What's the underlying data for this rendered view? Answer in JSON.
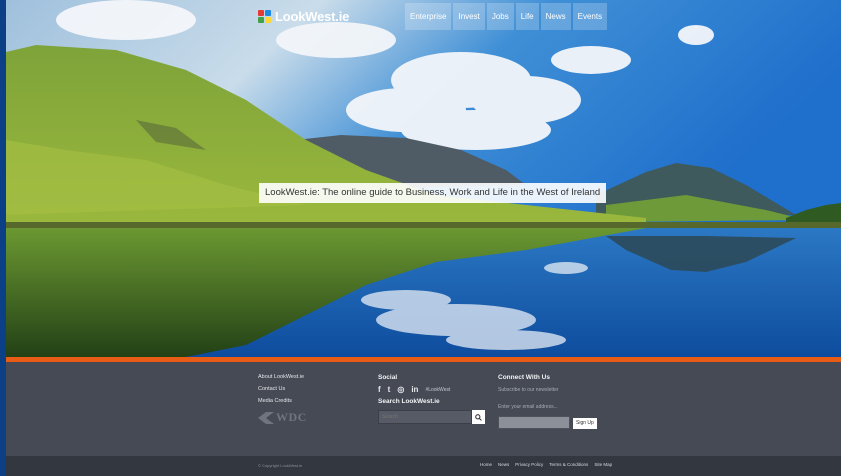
{
  "site": {
    "logo_text": "LookWest.ie",
    "tagline": "LookWest.ie: The online guide to Business, Work and Life in the West of Ireland"
  },
  "nav": {
    "items": [
      {
        "label": "Enterprise"
      },
      {
        "label": "Invest"
      },
      {
        "label": "Jobs"
      },
      {
        "label": "Life"
      },
      {
        "label": "News"
      },
      {
        "label": "Events"
      }
    ]
  },
  "footer": {
    "links": [
      {
        "label": "About LookWest.ie"
      },
      {
        "label": "Contact Us"
      },
      {
        "label": "Media Credits"
      }
    ],
    "partner_logo_text": "WDC",
    "social": {
      "title": "Social",
      "icons": [
        "facebook-icon",
        "twitter-icon",
        "instagram-icon",
        "linkedin-icon"
      ],
      "icon_glyphs": [
        "f",
        "t",
        "◎",
        "in"
      ],
      "hashtag": "#LookWest"
    },
    "search": {
      "title": "Search LookWest.ie",
      "placeholder": "Search"
    },
    "connect": {
      "title": "Connect With Us",
      "subtitle": "Subscribe to our newsletter",
      "email_label": "Enter your email address...",
      "email_value": "",
      "signup_label": "Sign Up"
    }
  },
  "bottom_bar": {
    "copyright": "© Copyright LookWest.ie",
    "links": [
      {
        "label": "Home"
      },
      {
        "label": "News"
      },
      {
        "label": "Privacy Policy"
      },
      {
        "label": "Terms & Conditions"
      },
      {
        "label": "Site Map"
      }
    ]
  },
  "colors": {
    "accent": "#e85c16",
    "footer_bg": "#454a54",
    "bottom_bar_bg": "#33373f",
    "page_bg": "#0b3f86"
  }
}
